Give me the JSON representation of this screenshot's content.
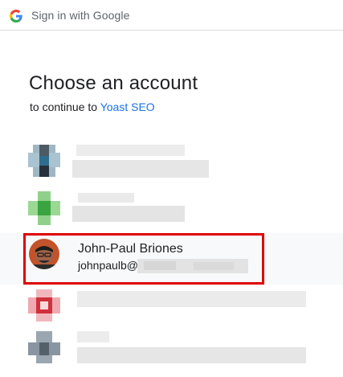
{
  "topbar": {
    "logo_icon": "google-g-icon",
    "label": "Sign in with Google"
  },
  "heading": "Choose an account",
  "subheading": {
    "prefix": "to continue to",
    "app_link": "Yoast SEO"
  },
  "accounts": [
    {
      "name": "",
      "email": "",
      "blurred": true
    },
    {
      "name": "",
      "email": "",
      "blurred": true
    },
    {
      "name": "John-Paul Briones",
      "email_visible": "johnpaulb@",
      "blurred": false
    },
    {
      "name": "",
      "email": "",
      "blurred": true
    },
    {
      "name": "",
      "email": "",
      "blurred": true
    }
  ],
  "colors": {
    "link": "#1a73e8",
    "highlight": "#e00000",
    "divider": "#dadce0"
  }
}
